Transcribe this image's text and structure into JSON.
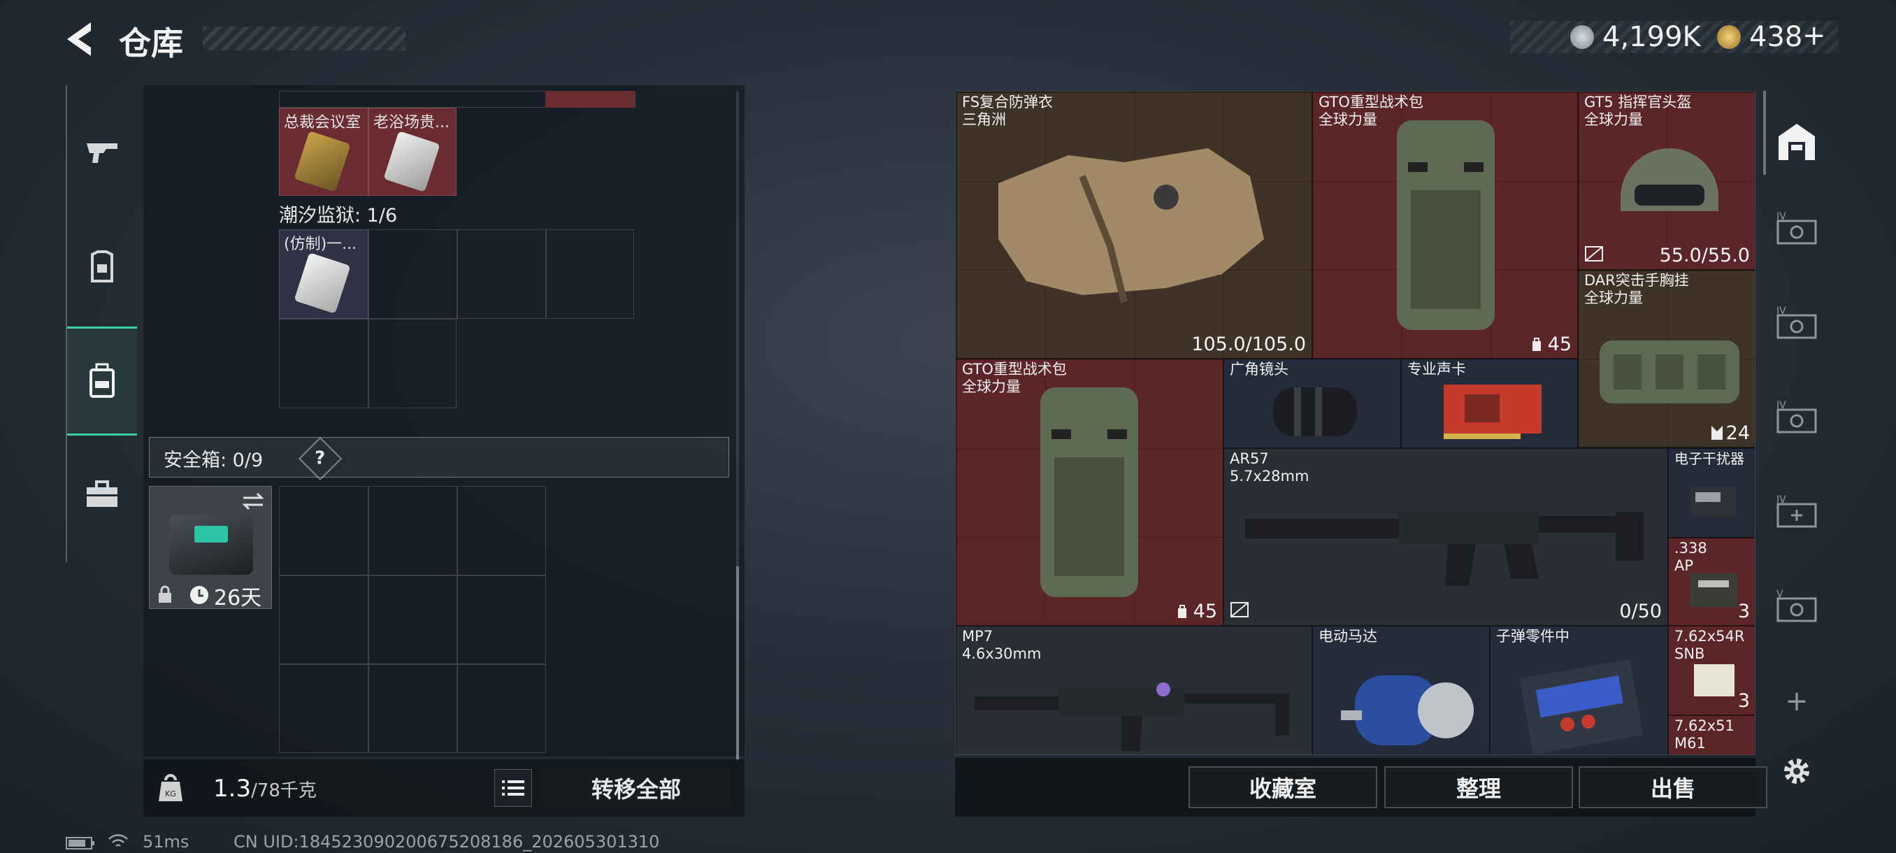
{
  "header": {
    "title": "仓库",
    "currency_silver": "4,199K",
    "currency_gold": "438",
    "gold_plus": "+"
  },
  "left_tabs": [
    {
      "name": "weapons",
      "icon": "gun-icon"
    },
    {
      "name": "armor",
      "icon": "armor-icon"
    },
    {
      "name": "storage",
      "icon": "backpack-icon"
    },
    {
      "name": "tools",
      "icon": "toolbox-icon"
    }
  ],
  "storage": {
    "items_top": [
      {
        "label": "总裁会议室"
      },
      {
        "label": "老浴场贵..."
      }
    ],
    "tidal_prison_label": "潮汐监狱: 1/6",
    "tidal_item_label": "(仿制)一...",
    "safe_label": "安全箱: 0/9",
    "safe_help": "?",
    "safe_timer": "26天",
    "weight_current": "1.3",
    "weight_max": "/78千克",
    "transfer_all": "转移全部"
  },
  "grid_items": {
    "armor": {
      "name": "FS复合防弹衣",
      "sub": "三角洲",
      "value": "105.0/105.0"
    },
    "backpack1": {
      "name": "GTO重型战术包",
      "sub": "全球力量",
      "value": "45"
    },
    "helmet": {
      "name": "GT5 指挥官头盔",
      "sub": "全球力量",
      "value": "55.0/55.0"
    },
    "rig": {
      "name": "DAR突击手胸挂",
      "sub": "全球力量",
      "value": "24"
    },
    "backpack2": {
      "name": "GTO重型战术包",
      "sub": "全球力量",
      "value": "45"
    },
    "lens": {
      "name": "广角镜头"
    },
    "soundcard": {
      "name": "专业声卡"
    },
    "rifle": {
      "name": "AR57",
      "sub": "5.7x28mm",
      "value": "0/50"
    },
    "jammer": {
      "name": "电子干扰器"
    },
    "ammo338": {
      "name": ".338",
      "sub": "AP",
      "value": "3"
    },
    "mp7": {
      "name": "MP7",
      "sub": "4.6x30mm"
    },
    "motor": {
      "name": "电动马达"
    },
    "bulletparts": {
      "name": "子弹零件中"
    },
    "ammo762": {
      "name": "7.62x54R",
      "sub": "SNB",
      "value": "3"
    },
    "ammo76251": {
      "name": "7.62x51",
      "sub": "M61"
    }
  },
  "bottom_buttons": {
    "collection": "收藏室",
    "organize": "整理",
    "sell": "出售"
  },
  "side_panel": {
    "labels": [
      "IV",
      "IV",
      "IV",
      "IV",
      "V"
    ],
    "add": "+"
  },
  "status_bar": {
    "ping": "51ms",
    "uid": "CN UID:184523090200675208186_202605301310"
  },
  "colors": {
    "accent": "#3fd0a8",
    "item_red": "#5c2629",
    "item_brown": "#3e3326"
  }
}
